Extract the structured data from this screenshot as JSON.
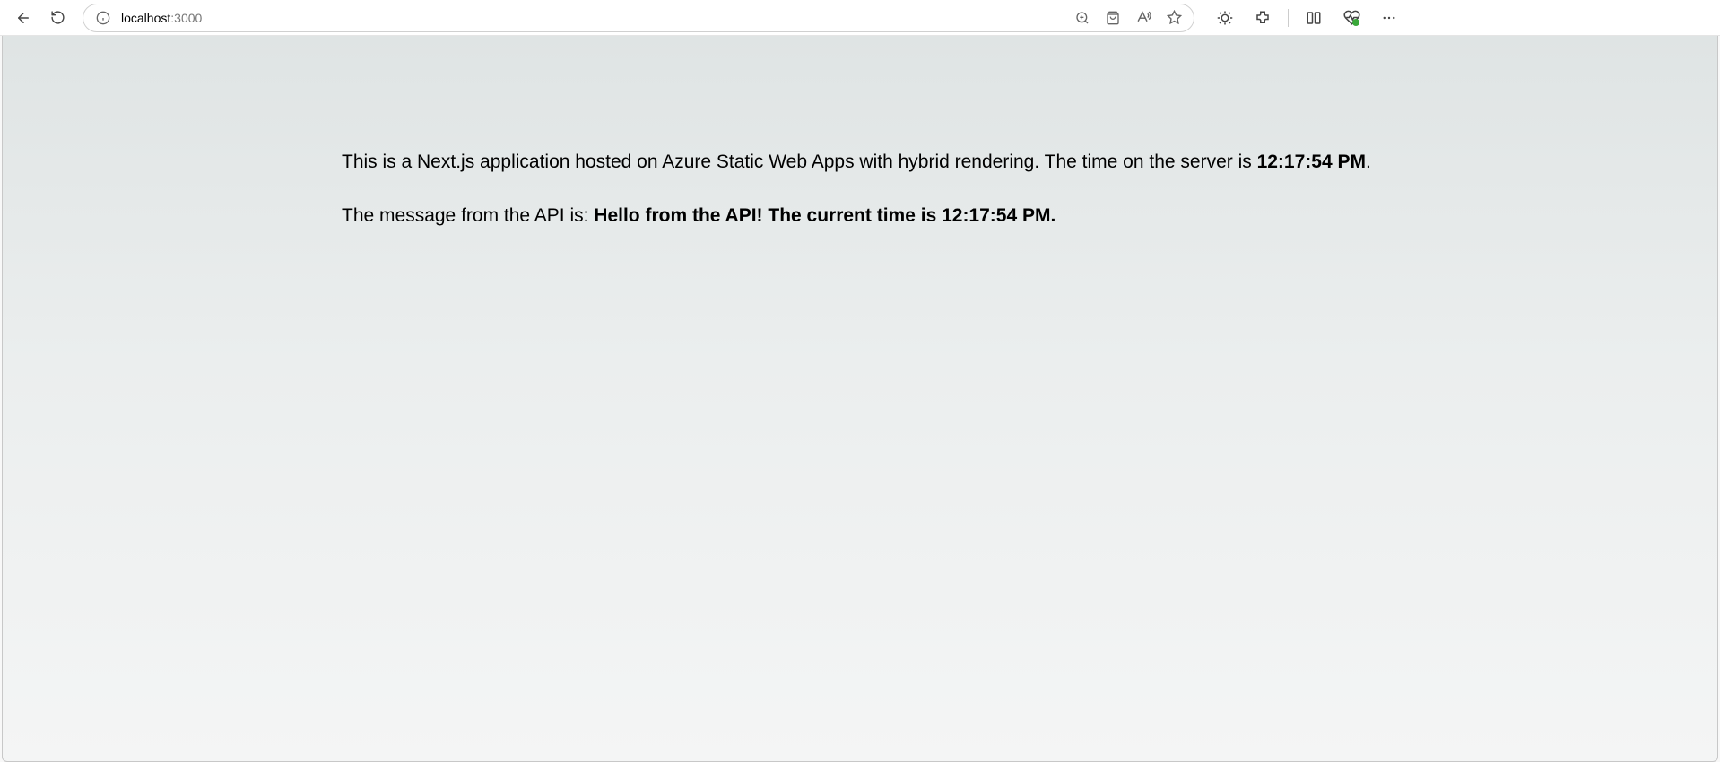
{
  "browser": {
    "url_host": "localhost",
    "url_port": ":3000"
  },
  "page": {
    "line1_prefix": "This is a Next.js application hosted on Azure Static Web Apps with hybrid rendering. The time on the server is ",
    "server_time": "12:17:54 PM",
    "line1_suffix": ".",
    "line2_prefix": "The message from the API is: ",
    "api_message": "Hello from the API! The current time is 12:17:54 PM."
  }
}
